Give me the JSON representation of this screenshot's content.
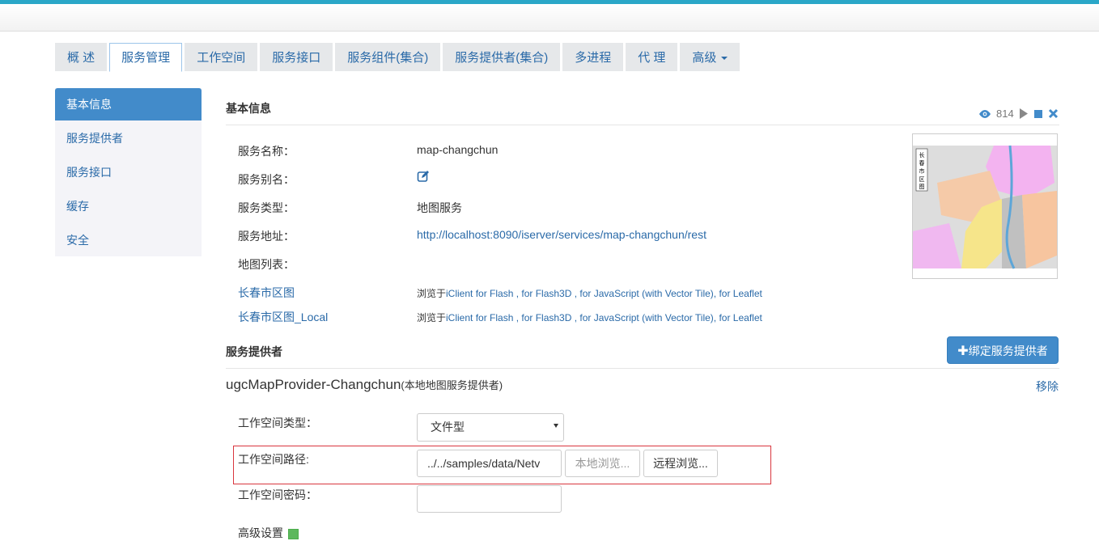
{
  "tabs": [
    {
      "label": "概 述"
    },
    {
      "label": "服务管理"
    },
    {
      "label": "工作空间"
    },
    {
      "label": "服务接口"
    },
    {
      "label": "服务组件(集合)"
    },
    {
      "label": "服务提供者(集合)"
    },
    {
      "label": "多进程"
    },
    {
      "label": "代 理"
    },
    {
      "label": "高级"
    }
  ],
  "sidebar": {
    "items": [
      {
        "label": "基本信息"
      },
      {
        "label": "服务提供者"
      },
      {
        "label": "服务接口"
      },
      {
        "label": "缓存"
      },
      {
        "label": "安全"
      }
    ]
  },
  "basic": {
    "title": "基本信息",
    "view_count": "814",
    "name_label": "服务名称：",
    "name_value": "map-changchun",
    "alias_label": "服务别名：",
    "type_label": "服务类型：",
    "type_value": "地图服务",
    "url_label": "服务地址：",
    "url_value": "http://localhost:8090/iserver/services/map-changchun/rest",
    "maplist_label": "地图列表：",
    "maps": [
      {
        "name": "长春市区图",
        "browse_prefix": "浏览于",
        "browse_links": "iClient for Flash , for Flash3D , for JavaScript (with Vector Tile), for Leaflet"
      },
      {
        "name": "长春市区图_Local",
        "browse_prefix": "浏览于",
        "browse_links": "iClient for Flash , for Flash3D , for JavaScript (with Vector Tile), for Leaflet"
      }
    ]
  },
  "provider": {
    "section_title": "服务提供者",
    "bind_button": "绑定服务提供者",
    "name": "ugcMapProvider-Changchun",
    "name_sub": "(本地地图服务提供者)",
    "remove_label": "移除",
    "ws_type_label": "工作空间类型：",
    "ws_type_value": "文件型",
    "ws_path_label": "工作空间路径:",
    "ws_path_value": "../../samples/data/Netv",
    "local_browse": "本地浏览...",
    "remote_browse": "远程浏览...",
    "ws_pwd_label": "工作空间密码：",
    "ws_pwd_value": "",
    "advanced_label": "高级设置"
  },
  "colors": {
    "accent": "#428bca",
    "link": "#2a6aa8",
    "topbar": "#2aa7c8",
    "highlight": "#d9363e"
  }
}
